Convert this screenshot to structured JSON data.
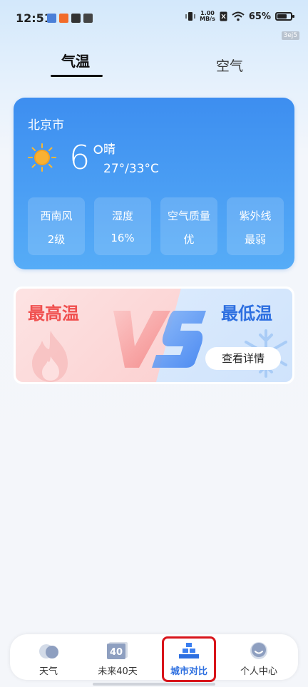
{
  "status_bar": {
    "time": "12:51",
    "speed_top": "1.00",
    "speed_unit": "MB/s",
    "battery": "65%",
    "watermark": "3ej5"
  },
  "tabs": [
    {
      "label": "气温",
      "active": true
    },
    {
      "label": "空气",
      "active": false
    }
  ],
  "weather": {
    "city": "北京市",
    "icon": "sun-icon",
    "temperature": "6°",
    "condition": "晴",
    "range": "27°/33°C",
    "stats": [
      {
        "label": "西南风",
        "value": "2级"
      },
      {
        "label": "湿度",
        "value": "16%"
      },
      {
        "label": "空气质量",
        "value": "优"
      },
      {
        "label": "紫外线",
        "value": "最弱"
      }
    ]
  },
  "compare": {
    "max_label": "最高温",
    "min_label": "最低温",
    "vs_text": "VS",
    "detail_button": "查看详情"
  },
  "nav": [
    {
      "label": "天气",
      "icon": "cloud-icon"
    },
    {
      "label": "未来40天",
      "icon": "calendar-40-icon",
      "badge": "40"
    },
    {
      "label": "城市对比",
      "icon": "city-blocks-icon",
      "active": true
    },
    {
      "label": "个人中心",
      "icon": "profile-face-icon"
    }
  ],
  "colors": {
    "accent": "#2d6fe0",
    "card_top": "#3d8ef0",
    "card_bottom": "#56acf7",
    "max_red": "#f0504f",
    "highlight": "#d8141a"
  }
}
